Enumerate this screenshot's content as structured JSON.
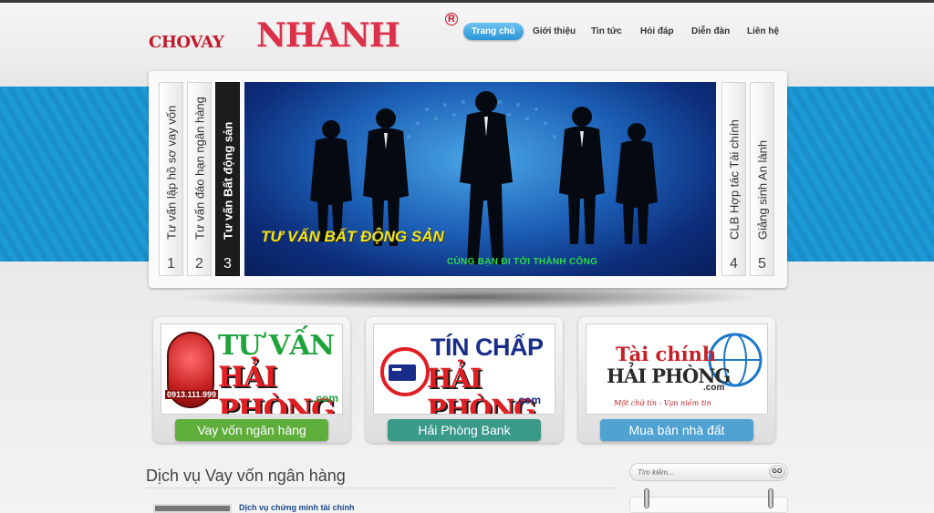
{
  "logo": {
    "small": "CHOVAY",
    "big": "NHANH",
    "mark": "R"
  },
  "nav": {
    "items": [
      {
        "label": "Trang chủ",
        "active": true
      },
      {
        "label": "Giới thiệu"
      },
      {
        "label": "Tin tức"
      },
      {
        "label": "Hỏi đáp"
      },
      {
        "label": "Diễn đàn"
      },
      {
        "label": "Liên hệ"
      }
    ]
  },
  "slider": {
    "tabs": [
      {
        "label": "Tư vấn lập hồ sơ vay vốn",
        "num": "1"
      },
      {
        "label": "Tư vấn đáo hạn ngân hàng",
        "num": "2"
      },
      {
        "label": "Tư vấn Bất động sản",
        "num": "3",
        "active": true
      },
      {
        "label": "CLB Hợp tác Tài chính",
        "num": "4"
      },
      {
        "label": "Giảng sinh An lành",
        "num": "5"
      }
    ],
    "slide_title": "TƯ VẤN BẤT ĐỘNG SẢN",
    "slide_sub": "CÙNG BẠN ĐI TỚI THÀNH CÔNG"
  },
  "cards": [
    {
      "line1": "TƯ VẤN",
      "line2": "HẢI PHÒNG",
      "com": ".com",
      "phone": "0913.111.999",
      "button": "Vay vốn ngân hàng",
      "button_color": "#5fae3c"
    },
    {
      "line1": "TÍN CHẤP",
      "line2": "HẢI PHÒNG",
      "com": ".com",
      "button": "Hải Phòng Bank",
      "button_color": "#3a9a8a"
    },
    {
      "line1": "Tài chính",
      "line2": "HẢI PHÒNG",
      "com": ".com",
      "slogan": "Một chữ tín - Vạn niềm tin",
      "button": "Mua bán nhà đất",
      "button_color": "#4fa2d2"
    }
  ],
  "section": {
    "title": "Dịch vụ Vay vốn ngân hàng",
    "first_item": "Dịch vụ chứng minh tài chính"
  },
  "search": {
    "placeholder": "Tìm kiếm...",
    "button": "GO"
  }
}
